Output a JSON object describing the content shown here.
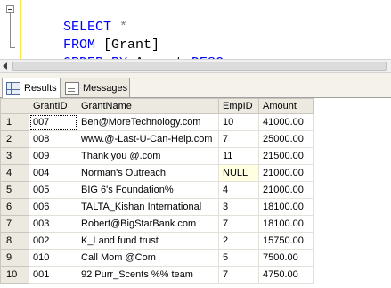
{
  "editor": {
    "lines": [
      {
        "keyword": "SELECT",
        "rest": " *"
      },
      {
        "keyword": "FROM",
        "rest": " [Grant]"
      },
      {
        "keyword": "ORDER BY",
        "rest": " Amount ",
        "keyword2": "DESC"
      }
    ]
  },
  "tabs": {
    "results": "Results",
    "messages": "Messages"
  },
  "grid": {
    "columns": [
      "GrantID",
      "GrantName",
      "EmpID",
      "Amount"
    ],
    "rows": [
      {
        "num": "1",
        "GrantID": "007",
        "GrantName": "Ben@MoreTechnology.com",
        "EmpID": "10",
        "Amount": "41000.00"
      },
      {
        "num": "2",
        "GrantID": "008",
        "GrantName": "www.@-Last-U-Can-Help.com",
        "EmpID": "7",
        "Amount": "25000.00"
      },
      {
        "num": "3",
        "GrantID": "009",
        "GrantName": "Thank you @.com",
        "EmpID": "11",
        "Amount": "21500.00"
      },
      {
        "num": "4",
        "GrantID": "004",
        "GrantName": "Norman's Outreach",
        "EmpID": "NULL",
        "Amount": "21000.00"
      },
      {
        "num": "5",
        "GrantID": "005",
        "GrantName": "BIG 6's Foundation%",
        "EmpID": "4",
        "Amount": "21000.00"
      },
      {
        "num": "6",
        "GrantID": "006",
        "GrantName": "TALTA_Kishan International",
        "EmpID": "3",
        "Amount": "18100.00"
      },
      {
        "num": "7",
        "GrantID": "003",
        "GrantName": "Robert@BigStarBank.com",
        "EmpID": "7",
        "Amount": "18100.00"
      },
      {
        "num": "8",
        "GrantID": "002",
        "GrantName": "K_Land fund trust",
        "EmpID": "2",
        "Amount": "15750.00"
      },
      {
        "num": "9",
        "GrantID": "010",
        "GrantName": "Call Mom @Com",
        "EmpID": "5",
        "Amount": "7500.00"
      },
      {
        "num": "10",
        "GrantID": "001",
        "GrantName": "92 Purr_Scents %% team",
        "EmpID": "7",
        "Amount": "4750.00"
      }
    ]
  },
  "colors": {
    "keyword": "#0000ff",
    "null_bg": "#ffffe1",
    "header_bg": "#ebe9e0"
  }
}
